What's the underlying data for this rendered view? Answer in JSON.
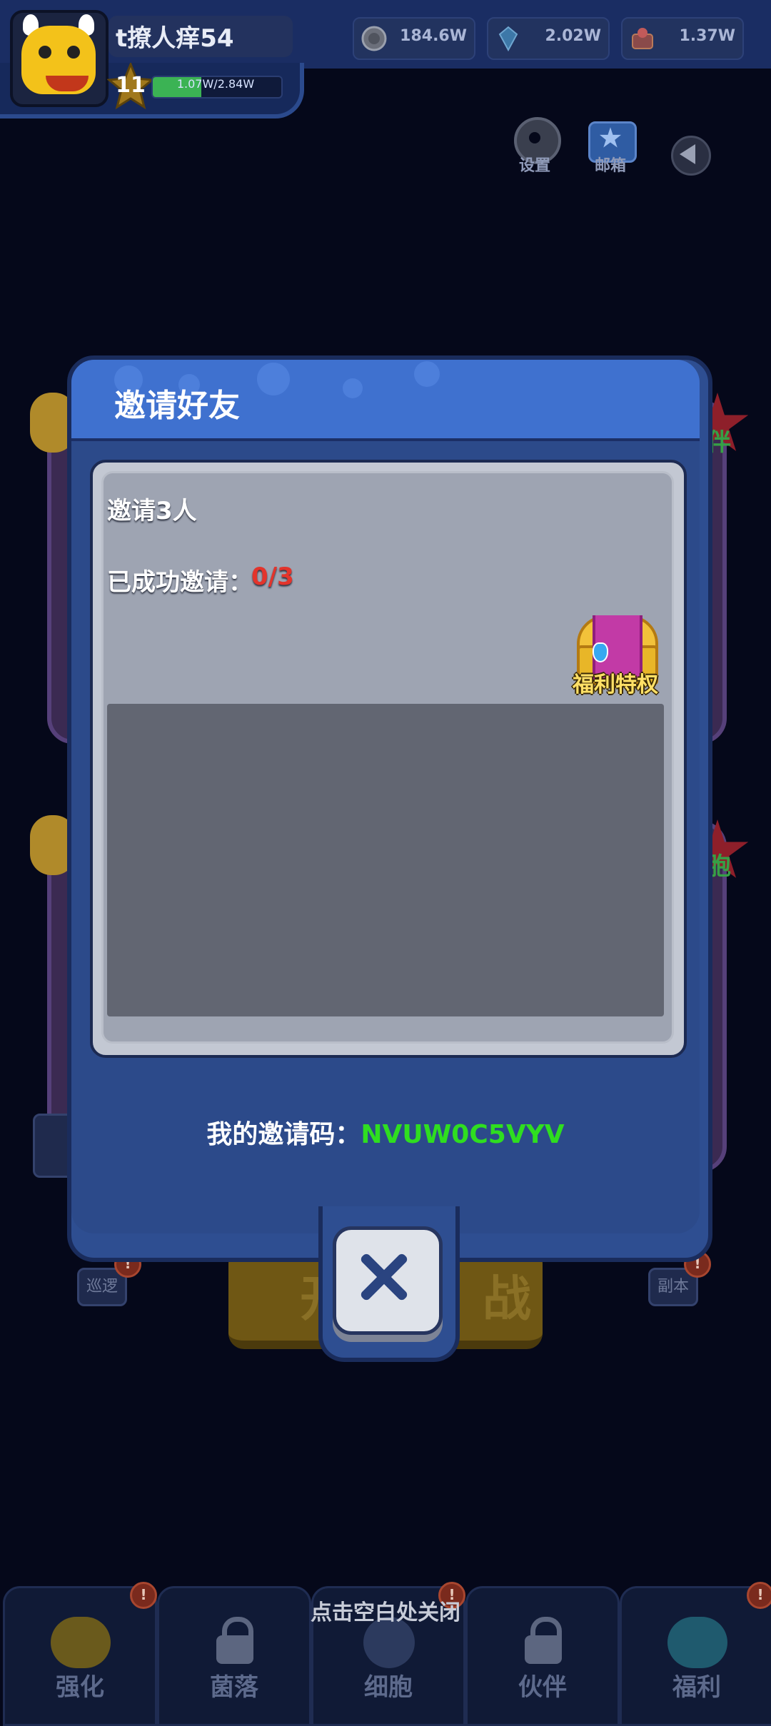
{
  "player": {
    "name": "t撩人痒54",
    "level": "11",
    "exp_text": "1.07W/2.84W",
    "exp_fraction": 0.38
  },
  "currencies": [
    {
      "icon": "coin-icon",
      "value": "184.6W"
    },
    {
      "icon": "diamond-icon",
      "value": "2.02W"
    },
    {
      "icon": "gem-chest-icon",
      "value": "1.37W"
    }
  ],
  "hud": {
    "settings_label": "设置",
    "mail_label": "邮箱"
  },
  "background": {
    "right_tag_top": "伴",
    "right_tag_bottom": "胞",
    "left_small_button": "巡逻",
    "right_small_button": "副本",
    "start_button": "开始战"
  },
  "dialog": {
    "title": "邀请好友",
    "invite_goal": "邀请3人",
    "progress_label": "已成功邀请：",
    "progress_value": "0/3",
    "reward_label": "福利特权",
    "code_label": "我的邀请码：",
    "code_value": "NVUW0C5VYV"
  },
  "close_hint": "点击空白处关闭",
  "nav": [
    {
      "label": "强化",
      "icon": "monster-icon",
      "locked": false,
      "alert": true
    },
    {
      "label": "菌落",
      "icon": "lock-icon",
      "locked": true,
      "alert": false
    },
    {
      "label": "细胞",
      "icon": "cell-icon",
      "locked": false,
      "alert": true
    },
    {
      "label": "伙伴",
      "icon": "lock-icon",
      "locked": true,
      "alert": false
    },
    {
      "label": "福利",
      "icon": "gift-icon",
      "locked": false,
      "alert": true
    }
  ],
  "colors": {
    "dialog_header": "#3f71cf",
    "dialog_body": "#2c4a8a",
    "progress_value": "#e3342c",
    "code_value": "#2fde20",
    "reward_label": "#ffe066"
  }
}
